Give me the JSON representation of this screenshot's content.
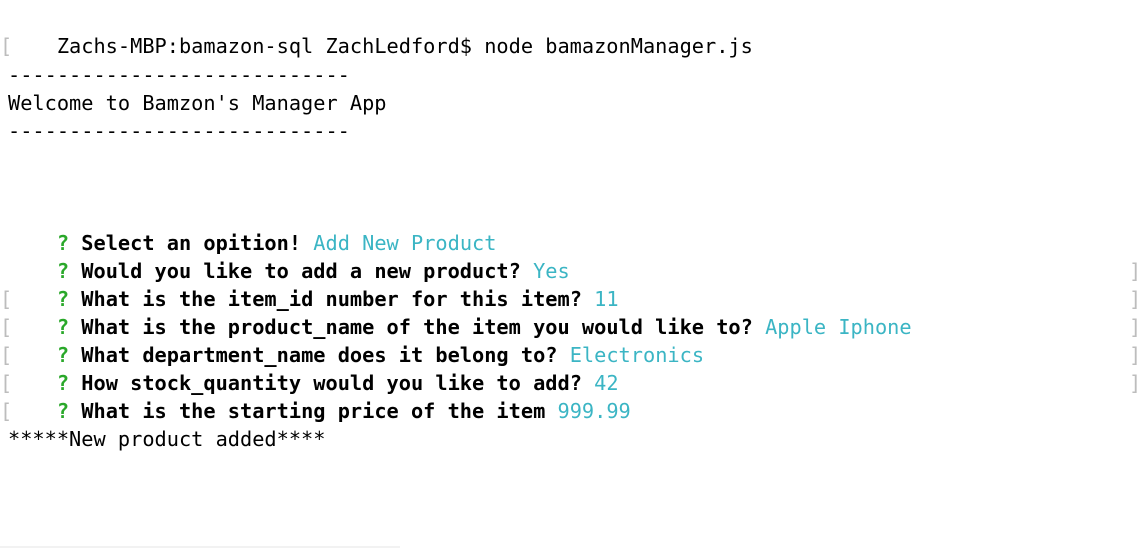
{
  "terminal": {
    "command_line": "Zachs-MBP:bamazon-sql ZachLedford$ node bamazonManager.js",
    "separator": "----------------------------",
    "welcome": "Welcome to Bamzon's Manager App",
    "question_mark": "?",
    "prompts": [
      {
        "text": "Select an opition!",
        "answer": "Add New Product"
      },
      {
        "text": "Would you like to add a new product?",
        "answer": "Yes"
      },
      {
        "text": "What is the item_id number for this item?",
        "answer": "11"
      },
      {
        "text": "What is the product_name of the item you would like to?",
        "answer": "Apple Iphone"
      },
      {
        "text": "What department_name does it belong to?",
        "answer": "Electronics"
      },
      {
        "text": "How stock_quantity would you like to add?",
        "answer": "42"
      },
      {
        "text": "What is the starting price of the item",
        "answer": "999.99"
      }
    ],
    "result": "*****New product added****"
  },
  "colors": {
    "prompt_mark": "#2aa82a",
    "answer": "#3bb5c4",
    "text": "#000000",
    "background": "#ffffff"
  }
}
